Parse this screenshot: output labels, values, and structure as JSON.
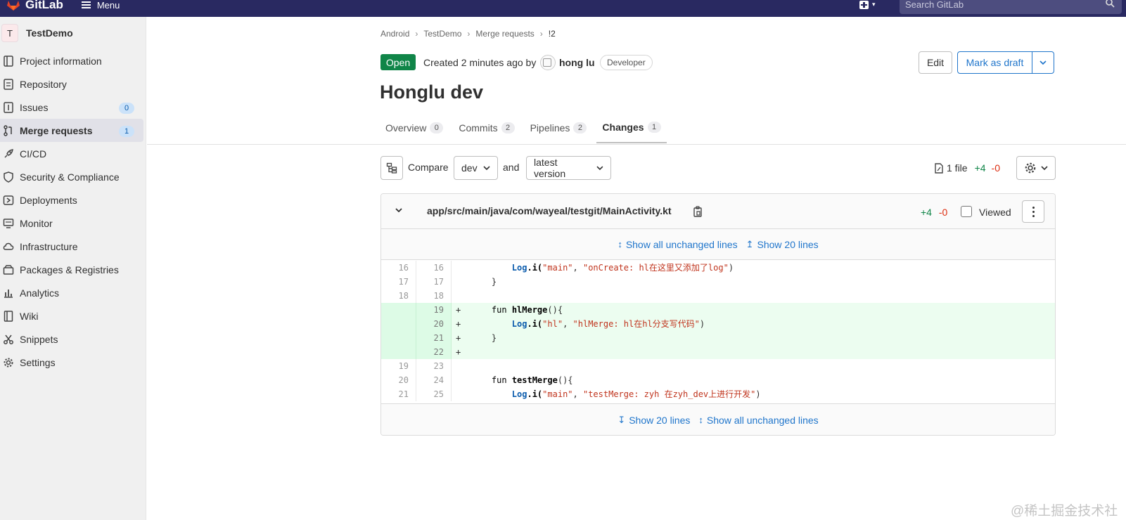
{
  "topbar": {
    "brand": "GitLab",
    "menu_label": "Menu",
    "search_placeholder": "Search GitLab"
  },
  "sidebar": {
    "project_initial": "T",
    "project_name": "TestDemo",
    "items": [
      {
        "label": "Project information",
        "icon": "info-icon"
      },
      {
        "label": "Repository",
        "icon": "doc-icon"
      },
      {
        "label": "Issues",
        "icon": "issues-icon",
        "count": "0"
      },
      {
        "label": "Merge requests",
        "icon": "merge-request-icon",
        "count": "1",
        "active": true
      },
      {
        "label": "CI/CD",
        "icon": "rocket-icon"
      },
      {
        "label": "Security & Compliance",
        "icon": "shield-icon"
      },
      {
        "label": "Deployments",
        "icon": "deployments-icon"
      },
      {
        "label": "Monitor",
        "icon": "monitor-icon"
      },
      {
        "label": "Infrastructure",
        "icon": "cloud-icon"
      },
      {
        "label": "Packages & Registries",
        "icon": "package-icon"
      },
      {
        "label": "Analytics",
        "icon": "chart-icon"
      },
      {
        "label": "Wiki",
        "icon": "book-icon"
      },
      {
        "label": "Snippets",
        "icon": "scissors-icon"
      },
      {
        "label": "Settings",
        "icon": "gear-icon"
      }
    ]
  },
  "breadcrumb": [
    "Android",
    "TestDemo",
    "Merge requests",
    "!2"
  ],
  "mr": {
    "status": "Open",
    "created_text": "Created 2 minutes ago by",
    "author": "hong lu",
    "role": "Developer",
    "title": "Honglu dev",
    "edit_label": "Edit",
    "draft_label": "Mark as draft"
  },
  "tabs": [
    {
      "label": "Overview",
      "count": "0"
    },
    {
      "label": "Commits",
      "count": "2"
    },
    {
      "label": "Pipelines",
      "count": "2"
    },
    {
      "label": "Changes",
      "count": "1",
      "active": true
    }
  ],
  "compare": {
    "compare_label": "Compare",
    "source": "dev",
    "and_label": "and",
    "target": "latest version",
    "files_label": "1 file",
    "additions": "+4",
    "deletions": "-0"
  },
  "diff": {
    "file_path": "app/src/main/java/com/wayeal/testgit/MainActivity.kt",
    "additions": "+4",
    "deletions": "-0",
    "viewed_label": "Viewed",
    "expand_all": "Show all unchanged lines",
    "expand_20": "Show 20 lines",
    "lines": [
      {
        "old": "16",
        "new": "16",
        "sign": "",
        "type": "context"
      },
      {
        "old": "17",
        "new": "17",
        "sign": "",
        "type": "context"
      },
      {
        "old": "18",
        "new": "18",
        "sign": "",
        "type": "context"
      },
      {
        "old": "",
        "new": "19",
        "sign": "+",
        "type": "added"
      },
      {
        "old": "",
        "new": "20",
        "sign": "+",
        "type": "added"
      },
      {
        "old": "",
        "new": "21",
        "sign": "+",
        "type": "added"
      },
      {
        "old": "",
        "new": "22",
        "sign": "+",
        "type": "added"
      },
      {
        "old": "19",
        "new": "23",
        "sign": "",
        "type": "context"
      },
      {
        "old": "20",
        "new": "24",
        "sign": "",
        "type": "context"
      },
      {
        "old": "21",
        "new": "25",
        "sign": "",
        "type": "context"
      }
    ],
    "code": {
      "l16_obj": "Log",
      "l16_fn": ".i(",
      "l16_s1": "\"main\"",
      "l16_comma": ", ",
      "l16_s2": "\"onCreate: hl在这里又添加了log\"",
      "l16_close": ")",
      "l17": "}",
      "l19_kw": "fun ",
      "l19_name": "hlMerge",
      "l19_rest": "(){",
      "l20_obj": "Log",
      "l20_fn": ".i(",
      "l20_s1": "\"hl\"",
      "l20_comma": ", ",
      "l20_s2": "\"hlMerge: hl在hl分支写代码\"",
      "l20_close": ")",
      "l21": "}",
      "l24_kw": "fun ",
      "l24_name": "testMerge",
      "l24_rest": "(){",
      "l25_obj": "Log",
      "l25_fn": ".i(",
      "l25_s1": "\"main\"",
      "l25_comma": ", ",
      "l25_s2": "\"testMerge: zyh 在zyh_dev上进行开发\"",
      "l25_close": ")"
    }
  },
  "watermark": "@稀土掘金技术社区",
  "colors": {
    "topbar": "#292961",
    "open_badge": "#108548",
    "link": "#1f75cb",
    "added_bg": "#ecfdf0",
    "deletion": "#dd2b0e"
  }
}
